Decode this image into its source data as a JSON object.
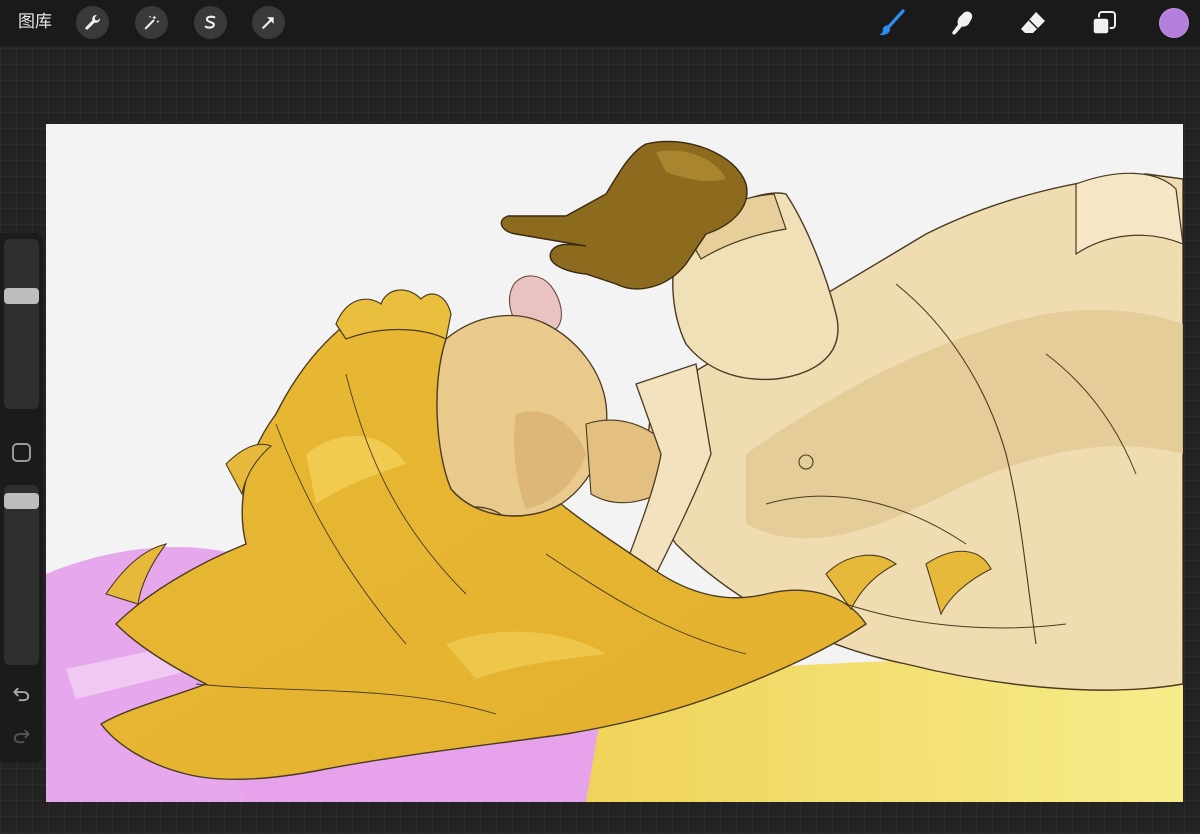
{
  "toolbar": {
    "gallery_label": "图库",
    "left_tools": [
      {
        "name": "actions",
        "icon": "wrench-icon"
      },
      {
        "name": "adjustments",
        "icon": "magic-wand-icon"
      },
      {
        "name": "selection",
        "icon": "selection-s-icon"
      },
      {
        "name": "transform",
        "icon": "arrow-cursor-icon"
      }
    ],
    "right_tools": [
      {
        "name": "brush",
        "icon": "brush-icon",
        "active": true
      },
      {
        "name": "smudge",
        "icon": "smudge-finger-icon"
      },
      {
        "name": "eraser",
        "icon": "eraser-icon"
      },
      {
        "name": "layers",
        "icon": "layers-icon"
      }
    ],
    "current_color": "#b57edc",
    "active_color": "#2e8ef0"
  },
  "sidebar": {
    "brush_size_level": 0.68,
    "opacity_level": 0.95,
    "icons": [
      "modify-square-icon",
      "undo-icon",
      "redo-icon"
    ]
  },
  "canvas": {
    "background": "#f3f3f3",
    "palette": {
      "hair": "#e6b93a",
      "hair_light": "#f1cf55",
      "skin": "#e9c98c",
      "coat": "#efdcb1",
      "coat_shade": "#e2c994",
      "glove": "#8c6a1e",
      "flower": "#e9c3c0",
      "purple": "#e6a6ec",
      "floor_yellow": "#f4e57a",
      "line": "#4a3a22"
    }
  }
}
